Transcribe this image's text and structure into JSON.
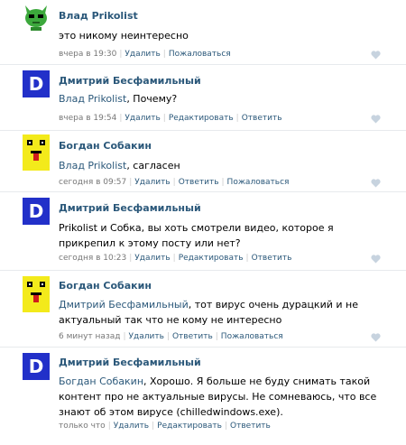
{
  "comments": [
    {
      "author": "Влад Prikolist",
      "reply_to": "",
      "text": "это никому неинтересно",
      "time": "вчера в 19:30",
      "actions": [
        "Удалить",
        "Пожаловаться"
      ],
      "avatar": "cat-avatar"
    },
    {
      "author": "Дмитрий Бесфамильный",
      "reply_to": "Влад Prikolist",
      "text": ", Почему?",
      "time": "вчера в 19:54",
      "actions": [
        "Удалить",
        "Редактировать",
        "Ответить"
      ],
      "avatar": "letter-d-avatar",
      "avatar_letter": "D"
    },
    {
      "author": "Богдан Собакин",
      "reply_to": "Влад Prikolist",
      "text": ", сагласен",
      "time": "сегодня в 09:57",
      "actions": [
        "Удалить",
        "Ответить",
        "Пожаловаться"
      ],
      "avatar": "sponge-avatar"
    },
    {
      "author": "Дмитрий Бесфамильный",
      "reply_to": "",
      "text": "Prikolist и Собка, вы хоть смотрели видео, которое я прикрепил к этому посту или нет?",
      "time": "сегодня в 10:23",
      "actions": [
        "Удалить",
        "Редактировать",
        "Ответить"
      ],
      "avatar": "letter-d-avatar",
      "avatar_letter": "D"
    },
    {
      "author": "Богдан Собакин",
      "reply_to": "Дмитрий Бесфамильный",
      "text": ", тот вирус очень дурацкий и не актуальный так что не кому не интересно",
      "time": "6 минут назад",
      "actions": [
        "Удалить",
        "Ответить",
        "Пожаловаться"
      ],
      "avatar": "sponge-avatar"
    },
    {
      "author": "Дмитрий Бесфамильный",
      "reply_to": "Богдан Собакин",
      "text": ", Хорошо. Я больше не буду снимать такой контент про не актуальные вирусы. Не сомневаюсь, что все знают об этом вирусе (chilledwindows.exe).",
      "time": "только что",
      "actions": [
        "Удалить",
        "Редактировать",
        "Ответить"
      ],
      "avatar": "letter-d-avatar",
      "avatar_letter": "D"
    }
  ],
  "colors": {
    "link": "#2b587a",
    "meta": "#777777",
    "avatar_d_bg": "#2230c9",
    "avatar_sponge_bg": "#f3ea1b",
    "avatar_cat": "#3ca83c"
  }
}
